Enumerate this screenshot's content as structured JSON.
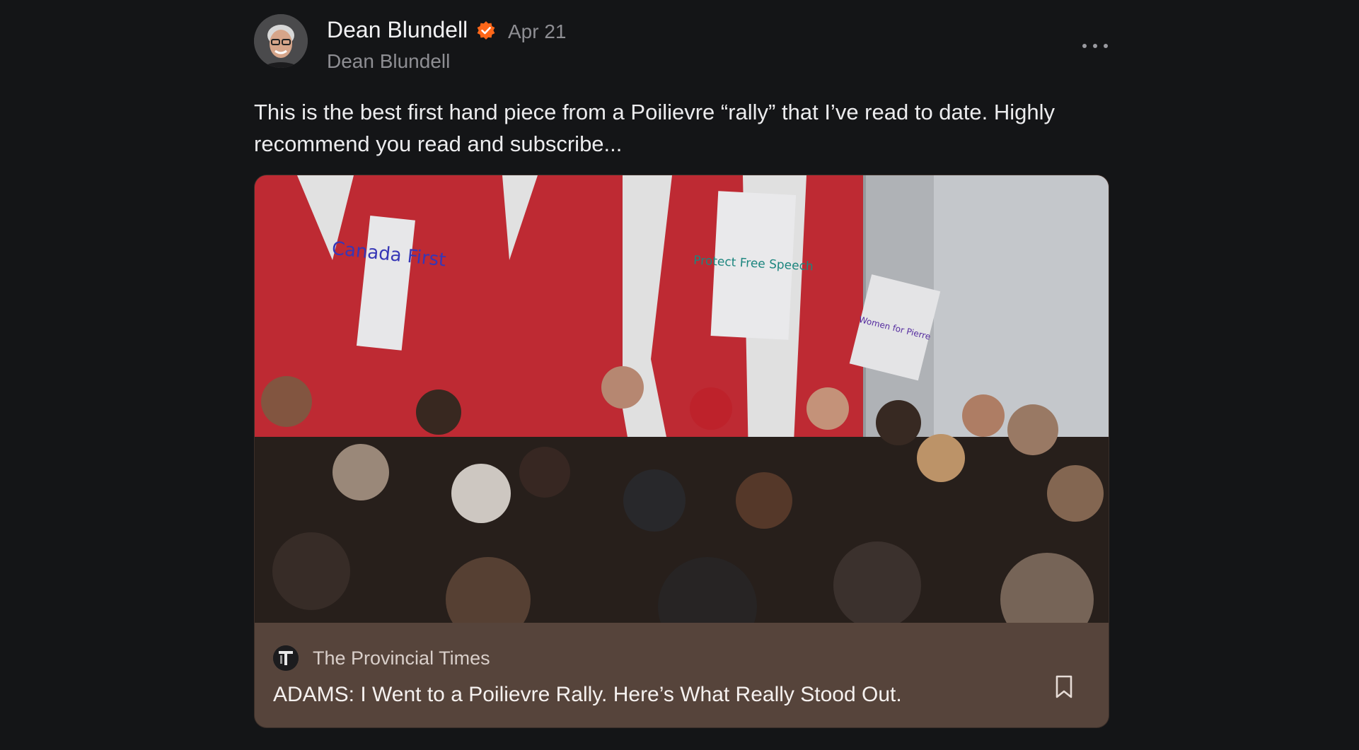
{
  "post": {
    "author_name": "Dean Blundell",
    "handle": "Dean Blundell",
    "date": "Apr 21",
    "verified": true,
    "text": "This is the best first hand piece from a Poilievre “rally” that I’ve read to date. Highly recommend you read and subscribe...",
    "icons": {
      "verified": "verified-badge-icon",
      "more": "more-options-icon"
    }
  },
  "card": {
    "publication": "The Provincial Times",
    "title": "ADAMS: I Went to a Poilievre Rally. Here’s What Really Stood Out.",
    "image_signs": [
      "Canada First",
      "Protect Free Speech",
      "Women for Pierre"
    ],
    "icons": {
      "bookmark": "bookmark-icon"
    }
  },
  "colors": {
    "background": "#141517",
    "card_footer": "#56443b",
    "verified_badge": "#ff6719",
    "muted_text": "#8e8e93"
  }
}
